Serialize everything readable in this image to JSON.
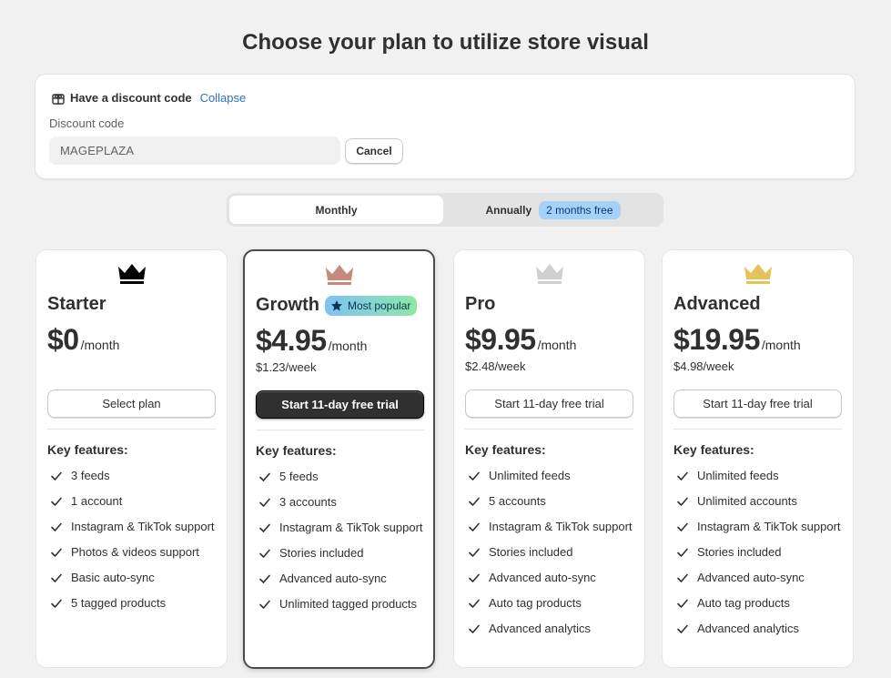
{
  "page": {
    "title": "Choose your plan to utilize store visual"
  },
  "discount": {
    "title": "Have a discount code",
    "collapse_label": "Collapse",
    "field_label": "Discount code",
    "value": "MAGEPLAZA",
    "cancel_label": "Cancel"
  },
  "billing": {
    "monthly_label": "Monthly",
    "annual_label": "Annually",
    "annual_badge": "2 months free",
    "selected": "Monthly"
  },
  "colors": {
    "starter_crown": "#000000",
    "growth_crown": "#c48a7c",
    "pro_crown": "#cfcfcf",
    "advanced_crown": "#e6c25a"
  },
  "plans": [
    {
      "name": "Starter",
      "price": "$0",
      "period": "/month",
      "weekly": "",
      "button": "Select plan",
      "features_title": "Key features:",
      "features": [
        "3 feeds",
        "1 account",
        "Instagram & TikTok support",
        "Photos & videos support",
        "Basic auto-sync",
        "5 tagged products"
      ]
    },
    {
      "name": "Growth",
      "badge": "Most popular",
      "price": "$4.95",
      "period": "/month",
      "weekly": "$1.23/week",
      "button": "Start 11-day free trial",
      "features_title": "Key features:",
      "features": [
        "5 feeds",
        "3 accounts",
        "Instagram & TikTok support",
        "Stories included",
        "Advanced auto-sync",
        "Unlimited tagged products"
      ]
    },
    {
      "name": "Pro",
      "price": "$9.95",
      "period": "/month",
      "weekly": "$2.48/week",
      "button": "Start 11-day free trial",
      "features_title": "Key features:",
      "features": [
        "Unlimited feeds",
        "5 accounts",
        "Instagram & TikTok support",
        "Stories included",
        "Advanced auto-sync",
        "Auto tag products",
        "Advanced analytics"
      ]
    },
    {
      "name": "Advanced",
      "price": "$19.95",
      "period": "/month",
      "weekly": "$4.98/week",
      "button": "Start 11-day free trial",
      "features_title": "Key features:",
      "features": [
        "Unlimited feeds",
        "Unlimited accounts",
        "Instagram & TikTok support",
        "Stories included",
        "Advanced auto-sync",
        "Auto tag products",
        "Advanced analytics"
      ]
    }
  ]
}
